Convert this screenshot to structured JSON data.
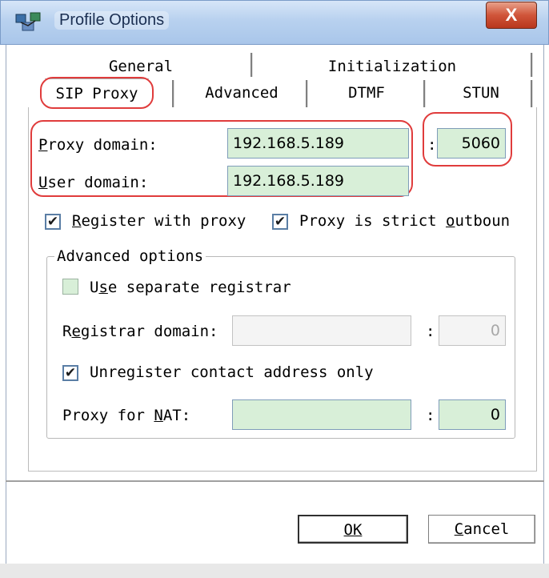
{
  "window": {
    "title": "Profile Options",
    "close_label": "X"
  },
  "tabs_back": [
    {
      "label": "General"
    },
    {
      "label": "Initialization"
    }
  ],
  "tabs_front": [
    {
      "label": "SIP Proxy",
      "selected": true
    },
    {
      "label": "Advanced"
    },
    {
      "label": "DTMF"
    },
    {
      "label": "STUN"
    }
  ],
  "proxy": {
    "proxy_domain_label": "Proxy domain:",
    "proxy_domain_value": "192.168.5.189",
    "proxy_port_value": "5060",
    "user_domain_label": "User domain:",
    "user_domain_value": "192.168.5.189",
    "colon": ":"
  },
  "options": {
    "register_with_proxy_label": "Register with proxy",
    "register_with_proxy_checked": true,
    "strict_outbound_label": "Proxy is strict outboun",
    "strict_outbound_checked": true
  },
  "advanced": {
    "group_title": "Advanced options",
    "separate_registrar_label": "Use separate registrar",
    "separate_registrar_checked": false,
    "registrar_domain_label": "Registrar domain:",
    "registrar_domain_value": "",
    "registrar_port_value": "0",
    "unregister_label": "Unregister contact address only",
    "unregister_checked": true,
    "nat_label": "Proxy for NAT:",
    "nat_value": "",
    "nat_port_value": "0"
  },
  "buttons": {
    "ok": "OK",
    "cancel": "Cancel"
  },
  "colors": {
    "annotation": "#e03c3c",
    "field_bg": "#d8efd8",
    "titlebar": "#b8d1ef"
  },
  "icons": {
    "app": "network-computers-icon",
    "check": "checkmark-icon"
  }
}
